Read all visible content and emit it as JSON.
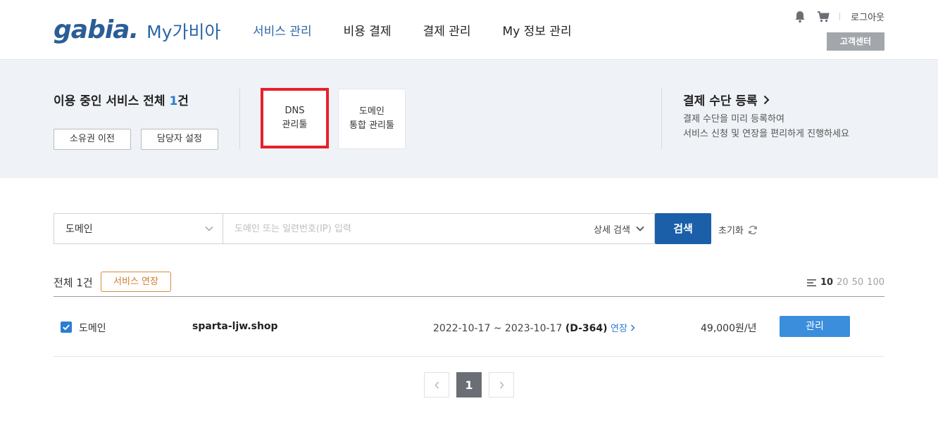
{
  "header": {
    "logo_text": "gabia.",
    "logo_sub": "My가비아",
    "nav": [
      {
        "label": "서비스 관리",
        "active": true
      },
      {
        "label": "비용 결제",
        "active": false
      },
      {
        "label": "결제 관리",
        "active": false
      },
      {
        "label": "My 정보 관리",
        "active": false
      }
    ],
    "icons": [
      "bell-icon",
      "cart-icon"
    ],
    "logout_label": "로그아웃",
    "customer_center_label": "고객센터"
  },
  "summary": {
    "title_prefix": "이용 중인 서비스 전체",
    "count": "1",
    "count_suffix": "건",
    "buttons": [
      "소유권 이전",
      "담당자 설정"
    ],
    "tools": [
      {
        "line1": "DNS",
        "line2": "관리툴",
        "highlighted": true
      },
      {
        "line1": "도메인",
        "line2": "통합 관리툴",
        "highlighted": false
      }
    ]
  },
  "payment": {
    "title": "결제 수단 등록",
    "desc_line1": "결제 수단을 미리 등록하여",
    "desc_line2": "서비스 신청 및 연장을 편리하게 진행하세요"
  },
  "search": {
    "category_value": "도메인",
    "placeholder": "도메인 또는 일련번호(IP) 입력",
    "detail_label": "상세 검색",
    "button_label": "검색",
    "reset_label": "초기화"
  },
  "list": {
    "total_label": "전체 1건",
    "extend_button": "서비스 연장",
    "page_sizes": [
      "10",
      "20",
      "50",
      "100"
    ],
    "selected_page_size": "10",
    "rows": [
      {
        "checked": true,
        "type": "도메인",
        "domain": "sparta-ljw.shop",
        "period": "2022-10-17 ~ 2023-10-17",
        "dday": "(D-364)",
        "extend_link": "연장",
        "price": "49,000원/년",
        "manage_label": "관리"
      }
    ]
  },
  "pagination": {
    "current": "1"
  },
  "colors": {
    "brand_blue": "#2b66a8",
    "search_button": "#1a5fa8",
    "manage_button": "#3a8edb",
    "highlight_red": "#e8202b",
    "extend_orange": "#d07a26"
  }
}
